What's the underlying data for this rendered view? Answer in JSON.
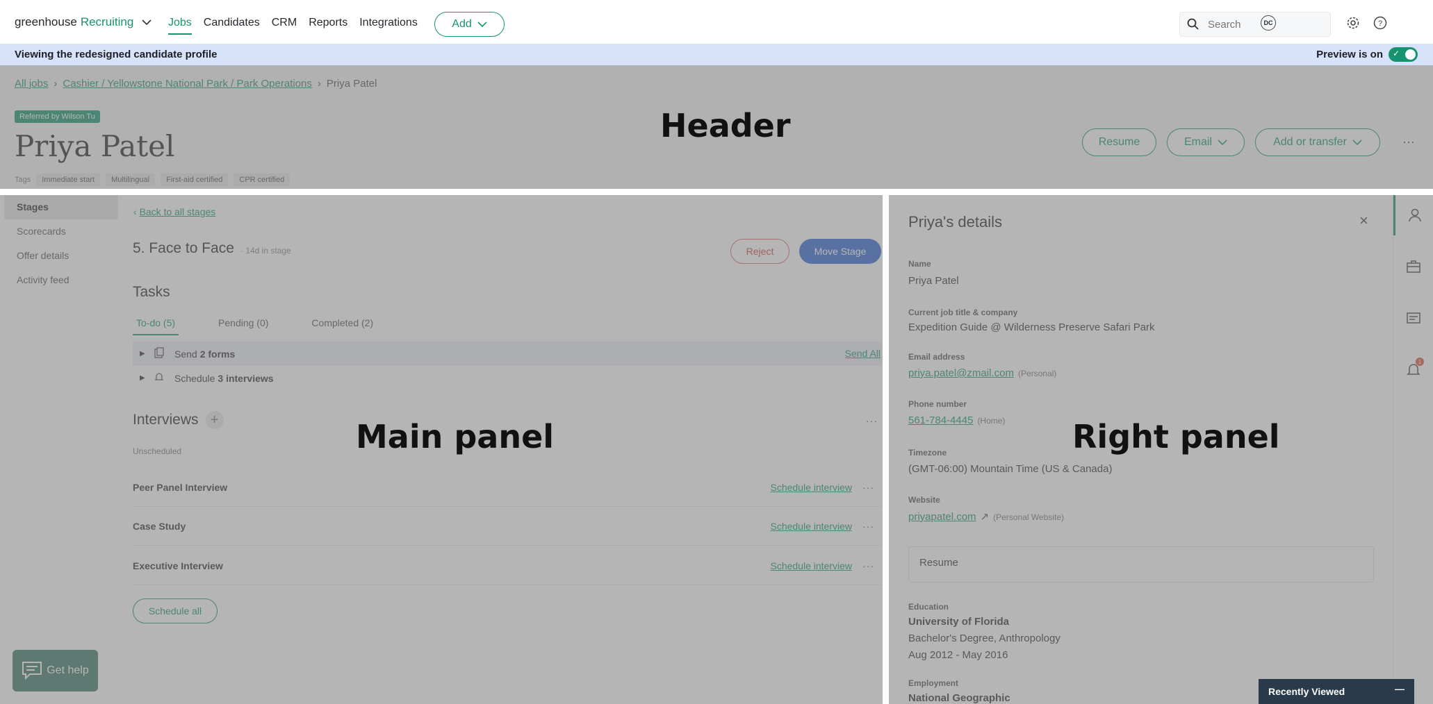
{
  "nav": {
    "brand_left": "greenhouse",
    "brand_right": "Recruiting",
    "links": [
      "Jobs",
      "Candidates",
      "CRM",
      "Reports",
      "Integrations"
    ],
    "add_label": "Add",
    "search_placeholder": "Search",
    "avatar_initials": "DC"
  },
  "banner": {
    "text": "Viewing the redesigned candidate profile",
    "preview_label": "Preview is on"
  },
  "header": {
    "crumbs": [
      "All jobs",
      "Cashier / Yellowstone National Park / Park Operations",
      "Priya Patel"
    ],
    "referral": "Referred by Wilson Tu",
    "name": "Priya Patel",
    "tags_label": "Tags",
    "tags": [
      "Immediate start",
      "Multilingual",
      "First-aid certified",
      "CPR certified"
    ],
    "btn_resume": "Resume",
    "btn_email": "Email",
    "btn_transfer": "Add or transfer",
    "more": "···"
  },
  "main": {
    "subnav": [
      "Stages",
      "Scorecards",
      "Offer details",
      "Activity feed"
    ],
    "back": "Back to all stages",
    "stage_title": "5. Face to Face",
    "stage_days": "· 14d in stage",
    "reject": "Reject",
    "move_stage": "Move Stage",
    "tasks_title": "Tasks",
    "task_tabs": [
      "To-do (5)",
      "Pending (0)",
      "Completed (2)"
    ],
    "task1_pre": "Send",
    "task1_bold": "2 forms",
    "task2_pre": "Schedule",
    "task2_bold": "3 interviews",
    "send_all": "Send All",
    "interviews_title": "Interviews",
    "unscheduled": "Unscheduled",
    "interviews": [
      {
        "name": "Peer Panel Interview",
        "action": "Schedule interview"
      },
      {
        "name": "Case Study",
        "action": "Schedule interview"
      },
      {
        "name": "Executive Interview",
        "action": "Schedule interview"
      }
    ],
    "schedule_all": "Schedule all",
    "get_help": "Get help"
  },
  "right": {
    "title": "Priya's details",
    "name_label": "Name",
    "name": "Priya Patel",
    "job_label": "Current job title & company",
    "job": "Expedition Guide @ Wilderness Preserve Safari Park",
    "email_label": "Email address",
    "email": "priya.patel@zmail.com",
    "email_note": "(Personal)",
    "phone_label": "Phone number",
    "phone": "561-784-4445",
    "phone_note": "(Home)",
    "tz_label": "Timezone",
    "tz": "(GMT-06:00) Mountain Time (US & Canada)",
    "web_label": "Website",
    "web": "priyapatel.com",
    "web_note": "(Personal Website)",
    "resume": "Resume",
    "edu_label": "Education",
    "edu_school": "University of Florida",
    "edu_degree": "Bachelor's Degree, Anthropology",
    "edu_dates": "Aug 2012 - May 2016",
    "emp_label": "Employment",
    "emp_company": "National Geographic",
    "notif_count": "1",
    "recent": "Recently Viewed"
  },
  "regions": {
    "header": "Header",
    "main": "Main panel",
    "right": "Right panel"
  },
  "colors": {
    "brand_green": "#15946f",
    "banner_blue": "#d6e3fb",
    "move_blue": "#3467d6",
    "reject_red": "#d04545"
  }
}
